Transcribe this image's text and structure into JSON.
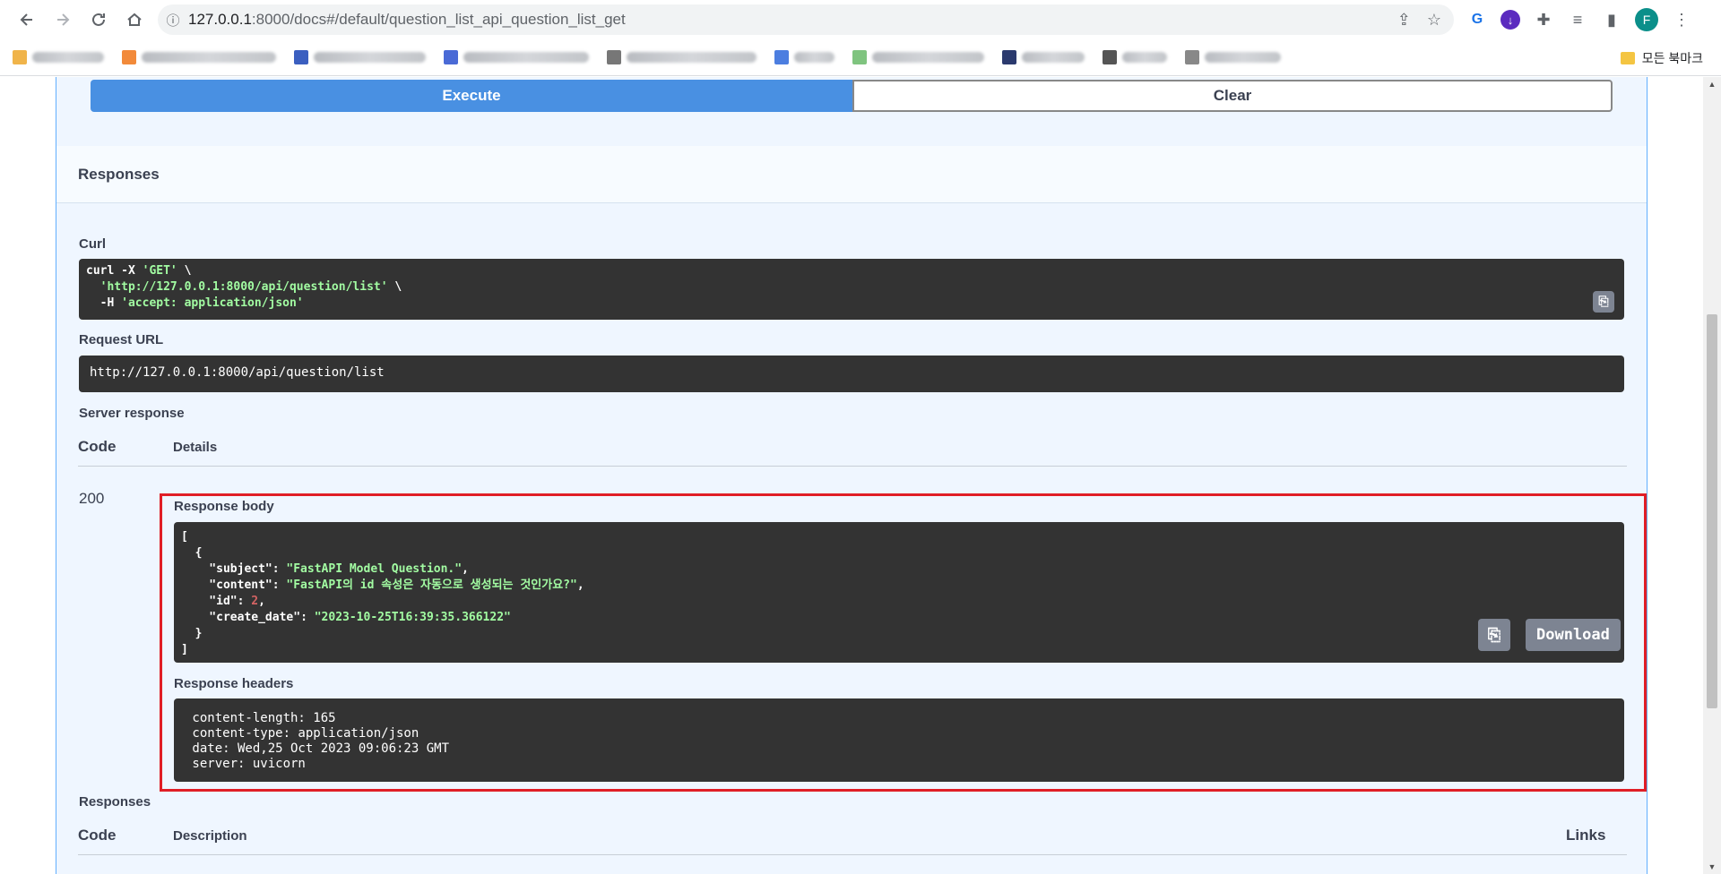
{
  "browser": {
    "url_host": "127.0.0.1",
    "url_rest": ":8000/docs#/default/question_list_api_question_list_get",
    "bookmark_folder": "모든 북마크",
    "avatar_letter": "F"
  },
  "swagger": {
    "execute_label": "Execute",
    "clear_label": "Clear",
    "responses_title": "Responses",
    "curl_label": "Curl",
    "curl_lines": {
      "l1_a": "curl -X ",
      "l1_b": "'GET'",
      "l1_c": " \\",
      "l2_a": "  ",
      "l2_b": "'http://127.0.0.1:8000/api/question/list'",
      "l2_c": " \\",
      "l3_a": "  -H ",
      "l3_b": "'accept: application/json'"
    },
    "request_url_label": "Request URL",
    "request_url": "http://127.0.0.1:8000/api/question/list",
    "server_response_label": "Server response",
    "col_code": "Code",
    "col_details": "Details",
    "status_code": "200",
    "response_body_label": "Response body",
    "body": {
      "open_bracket": "[",
      "open_brace": "  {",
      "subject_key": "    \"subject\"",
      "subject_val": "\"FastAPI Model Question.\"",
      "content_key": "    \"content\"",
      "content_val": "\"FastAPI의 id 속성은 자동으로 생성되는 것인가요?\"",
      "id_key": "    \"id\"",
      "id_val": "2",
      "date_key": "    \"create_date\"",
      "date_val": "\"2023-10-25T16:39:35.366122\"",
      "close_brace": "  }",
      "close_bracket": "]"
    },
    "download_label": "Download",
    "response_headers_label": "Response headers",
    "headers": [
      " content-length: 165 ",
      " content-type: application/json ",
      " date: Wed,25 Oct 2023 09:06:23 GMT ",
      " server: uvicorn "
    ],
    "responses_label_2": "Responses",
    "col_code_2": "Code",
    "col_description": "Description",
    "col_links": "Links"
  },
  "colors": {
    "execute": "#4990e2",
    "highlight_border": "#e01e26",
    "code_bg": "#333333",
    "string": "#a2fca2",
    "number": "#d36363"
  }
}
